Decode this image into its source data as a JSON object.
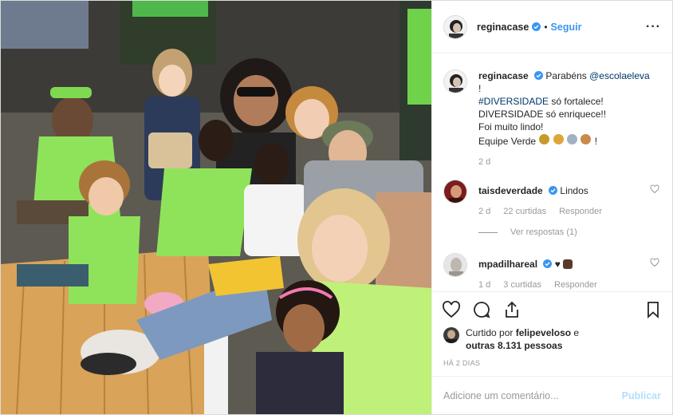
{
  "post": {
    "username": "reginacase",
    "follow_label": "Seguir",
    "more_icon": "more-options-icon"
  },
  "caption": {
    "username": "reginacase",
    "text_before_mention": "Parabéns",
    "mention": "@escolaeleva",
    "line_exclaim": "!",
    "hashtag": "#DIVERSIDADE",
    "line1_rest": "só fortalece!",
    "line2": "DIVERSIDADE só enriquece!!",
    "line3": "Foi muito lindo!",
    "line4_text": "Equipe Verde",
    "line4_end": "!",
    "time": "2 d"
  },
  "comments": [
    {
      "username": "taisdeverdade",
      "text": "Lindos",
      "time": "2 d",
      "likes": "22 curtidas",
      "reply_label": "Responder",
      "view_replies": "Ver respostas (1)"
    },
    {
      "username": "mpadilhareal",
      "text": "♥",
      "time": "1 d",
      "likes": "3 curtidas",
      "reply_label": "Responder"
    }
  ],
  "likes": {
    "prefix": "Curtido por",
    "user": "felipeveloso",
    "middle": "e",
    "others": "outras 8.131 pessoas"
  },
  "timestamp": "HÁ 2 DIAS",
  "add_comment": {
    "placeholder": "Adicione um comentário...",
    "post_label": "Publicar"
  },
  "colors": {
    "accent_blue": "#3897f0",
    "link": "#003569",
    "jersey_green": "#8fe35a",
    "muted": "#999999"
  }
}
